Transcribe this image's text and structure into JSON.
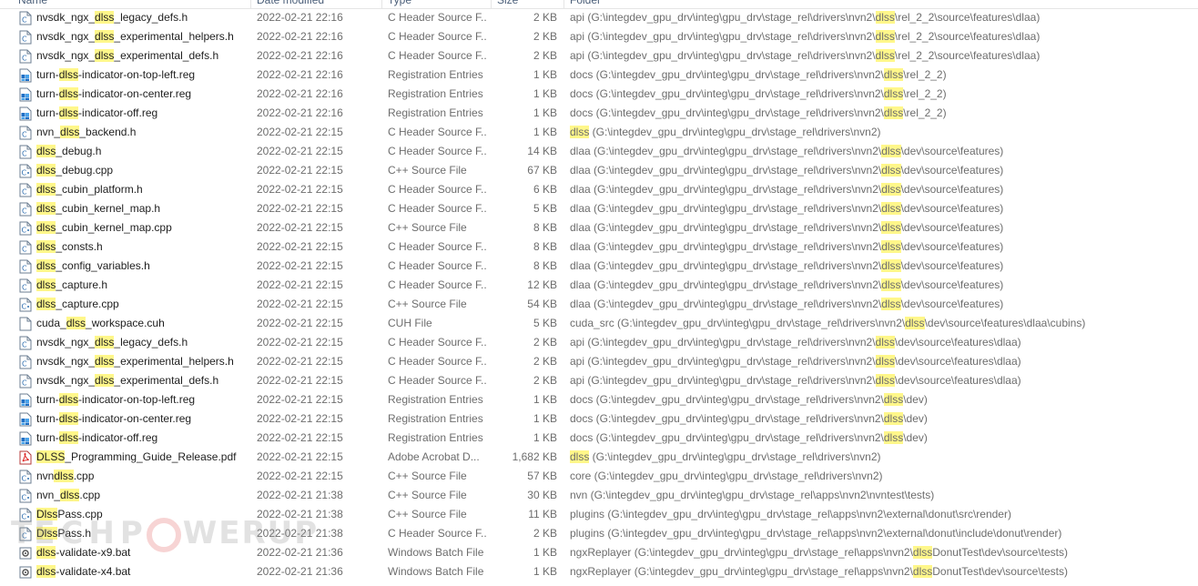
{
  "header": {
    "name": "Name",
    "date_modified": "Date modified",
    "type": "Type",
    "size": "Size",
    "folder": "Folder"
  },
  "highlight_term": "dlss",
  "colors": {
    "highlight": "#fff78a",
    "header_text": "#4c607a",
    "muted_text": "#6d6d6d"
  },
  "rows": [
    {
      "name": "nvsdk_ngx_dlss_legacy_defs.h",
      "date": "2022-02-21 22:16",
      "type": "C Header Source F...",
      "size": "2 KB",
      "folder": "api (G:\\integdev_gpu_drv\\integ\\gpu_drv\\stage_rel\\drivers\\nvn2\\dlss\\rel_2_2\\source\\features\\dlaa)",
      "icon": "c-header-file-icon"
    },
    {
      "name": "nvsdk_ngx_dlss_experimental_helpers.h",
      "date": "2022-02-21 22:16",
      "type": "C Header Source F...",
      "size": "2 KB",
      "folder": "api (G:\\integdev_gpu_drv\\integ\\gpu_drv\\stage_rel\\drivers\\nvn2\\dlss\\rel_2_2\\source\\features\\dlaa)",
      "icon": "c-header-file-icon"
    },
    {
      "name": "nvsdk_ngx_dlss_experimental_defs.h",
      "date": "2022-02-21 22:16",
      "type": "C Header Source F...",
      "size": "2 KB",
      "folder": "api (G:\\integdev_gpu_drv\\integ\\gpu_drv\\stage_rel\\drivers\\nvn2\\dlss\\rel_2_2\\source\\features\\dlaa)",
      "icon": "c-header-file-icon"
    },
    {
      "name": "turn-dlss-indicator-on-top-left.reg",
      "date": "2022-02-21 22:16",
      "type": "Registration Entries",
      "size": "1 KB",
      "folder": "docs (G:\\integdev_gpu_drv\\integ\\gpu_drv\\stage_rel\\drivers\\nvn2\\dlss\\rel_2_2)",
      "icon": "registry-file-icon"
    },
    {
      "name": "turn-dlss-indicator-on-center.reg",
      "date": "2022-02-21 22:16",
      "type": "Registration Entries",
      "size": "1 KB",
      "folder": "docs (G:\\integdev_gpu_drv\\integ\\gpu_drv\\stage_rel\\drivers\\nvn2\\dlss\\rel_2_2)",
      "icon": "registry-file-icon"
    },
    {
      "name": "turn-dlss-indicator-off.reg",
      "date": "2022-02-21 22:16",
      "type": "Registration Entries",
      "size": "1 KB",
      "folder": "docs (G:\\integdev_gpu_drv\\integ\\gpu_drv\\stage_rel\\drivers\\nvn2\\dlss\\rel_2_2)",
      "icon": "registry-file-icon"
    },
    {
      "name": "nvn_dlss_backend.h",
      "date": "2022-02-21 22:15",
      "type": "C Header Source F...",
      "size": "1 KB",
      "folder": "dlss (G:\\integdev_gpu_drv\\integ\\gpu_drv\\stage_rel\\drivers\\nvn2)",
      "icon": "c-header-file-icon"
    },
    {
      "name": "dlss_debug.h",
      "date": "2022-02-21 22:15",
      "type": "C Header Source F...",
      "size": "14 KB",
      "folder": "dlaa (G:\\integdev_gpu_drv\\integ\\gpu_drv\\stage_rel\\drivers\\nvn2\\dlss\\dev\\source\\features)",
      "icon": "c-header-file-icon"
    },
    {
      "name": "dlss_debug.cpp",
      "date": "2022-02-21 22:15",
      "type": "C++ Source File",
      "size": "67 KB",
      "folder": "dlaa (G:\\integdev_gpu_drv\\integ\\gpu_drv\\stage_rel\\drivers\\nvn2\\dlss\\dev\\source\\features)",
      "icon": "cpp-file-icon"
    },
    {
      "name": "dlss_cubin_platform.h",
      "date": "2022-02-21 22:15",
      "type": "C Header Source F...",
      "size": "6 KB",
      "folder": "dlaa (G:\\integdev_gpu_drv\\integ\\gpu_drv\\stage_rel\\drivers\\nvn2\\dlss\\dev\\source\\features)",
      "icon": "c-header-file-icon"
    },
    {
      "name": "dlss_cubin_kernel_map.h",
      "date": "2022-02-21 22:15",
      "type": "C Header Source F...",
      "size": "5 KB",
      "folder": "dlaa (G:\\integdev_gpu_drv\\integ\\gpu_drv\\stage_rel\\drivers\\nvn2\\dlss\\dev\\source\\features)",
      "icon": "c-header-file-icon"
    },
    {
      "name": "dlss_cubin_kernel_map.cpp",
      "date": "2022-02-21 22:15",
      "type": "C++ Source File",
      "size": "8 KB",
      "folder": "dlaa (G:\\integdev_gpu_drv\\integ\\gpu_drv\\stage_rel\\drivers\\nvn2\\dlss\\dev\\source\\features)",
      "icon": "cpp-file-icon"
    },
    {
      "name": "dlss_consts.h",
      "date": "2022-02-21 22:15",
      "type": "C Header Source F...",
      "size": "8 KB",
      "folder": "dlaa (G:\\integdev_gpu_drv\\integ\\gpu_drv\\stage_rel\\drivers\\nvn2\\dlss\\dev\\source\\features)",
      "icon": "c-header-file-icon"
    },
    {
      "name": "dlss_config_variables.h",
      "date": "2022-02-21 22:15",
      "type": "C Header Source F...",
      "size": "8 KB",
      "folder": "dlaa (G:\\integdev_gpu_drv\\integ\\gpu_drv\\stage_rel\\drivers\\nvn2\\dlss\\dev\\source\\features)",
      "icon": "c-header-file-icon"
    },
    {
      "name": "dlss_capture.h",
      "date": "2022-02-21 22:15",
      "type": "C Header Source F...",
      "size": "12 KB",
      "folder": "dlaa (G:\\integdev_gpu_drv\\integ\\gpu_drv\\stage_rel\\drivers\\nvn2\\dlss\\dev\\source\\features)",
      "icon": "c-header-file-icon"
    },
    {
      "name": "dlss_capture.cpp",
      "date": "2022-02-21 22:15",
      "type": "C++ Source File",
      "size": "54 KB",
      "folder": "dlaa (G:\\integdev_gpu_drv\\integ\\gpu_drv\\stage_rel\\drivers\\nvn2\\dlss\\dev\\source\\features)",
      "icon": "cpp-file-icon"
    },
    {
      "name": "cuda_dlss_workspace.cuh",
      "date": "2022-02-21 22:15",
      "type": "CUH File",
      "size": "5 KB",
      "folder": "cuda_src (G:\\integdev_gpu_drv\\integ\\gpu_drv\\stage_rel\\drivers\\nvn2\\dlss\\dev\\source\\features\\dlaa\\cubins)",
      "icon": "generic-file-icon"
    },
    {
      "name": "nvsdk_ngx_dlss_legacy_defs.h",
      "date": "2022-02-21 22:15",
      "type": "C Header Source F...",
      "size": "2 KB",
      "folder": "api (G:\\integdev_gpu_drv\\integ\\gpu_drv\\stage_rel\\drivers\\nvn2\\dlss\\dev\\source\\features\\dlaa)",
      "icon": "c-header-file-icon"
    },
    {
      "name": "nvsdk_ngx_dlss_experimental_helpers.h",
      "date": "2022-02-21 22:15",
      "type": "C Header Source F...",
      "size": "2 KB",
      "folder": "api (G:\\integdev_gpu_drv\\integ\\gpu_drv\\stage_rel\\drivers\\nvn2\\dlss\\dev\\source\\features\\dlaa)",
      "icon": "c-header-file-icon"
    },
    {
      "name": "nvsdk_ngx_dlss_experimental_defs.h",
      "date": "2022-02-21 22:15",
      "type": "C Header Source F...",
      "size": "2 KB",
      "folder": "api (G:\\integdev_gpu_drv\\integ\\gpu_drv\\stage_rel\\drivers\\nvn2\\dlss\\dev\\source\\features\\dlaa)",
      "icon": "c-header-file-icon"
    },
    {
      "name": "turn-dlss-indicator-on-top-left.reg",
      "date": "2022-02-21 22:15",
      "type": "Registration Entries",
      "size": "1 KB",
      "folder": "docs (G:\\integdev_gpu_drv\\integ\\gpu_drv\\stage_rel\\drivers\\nvn2\\dlss\\dev)",
      "icon": "registry-file-icon"
    },
    {
      "name": "turn-dlss-indicator-on-center.reg",
      "date": "2022-02-21 22:15",
      "type": "Registration Entries",
      "size": "1 KB",
      "folder": "docs (G:\\integdev_gpu_drv\\integ\\gpu_drv\\stage_rel\\drivers\\nvn2\\dlss\\dev)",
      "icon": "registry-file-icon"
    },
    {
      "name": "turn-dlss-indicator-off.reg",
      "date": "2022-02-21 22:15",
      "type": "Registration Entries",
      "size": "1 KB",
      "folder": "docs (G:\\integdev_gpu_drv\\integ\\gpu_drv\\stage_rel\\drivers\\nvn2\\dlss\\dev)",
      "icon": "registry-file-icon"
    },
    {
      "name": "DLSS_Programming_Guide_Release.pdf",
      "date": "2022-02-21 22:15",
      "type": "Adobe Acrobat D...",
      "size": "1,682 KB",
      "folder": "dlss (G:\\integdev_gpu_drv\\integ\\gpu_drv\\stage_rel\\drivers\\nvn2)",
      "icon": "pdf-file-icon"
    },
    {
      "name": "nvndlss.cpp",
      "date": "2022-02-21 22:15",
      "type": "C++ Source File",
      "size": "57 KB",
      "folder": "core (G:\\integdev_gpu_drv\\integ\\gpu_drv\\stage_rel\\drivers\\nvn2)",
      "icon": "cpp-file-icon"
    },
    {
      "name": "nvn_dlss.cpp",
      "date": "2022-02-21 21:38",
      "type": "C++ Source File",
      "size": "30 KB",
      "folder": "nvn (G:\\integdev_gpu_drv\\integ\\gpu_drv\\stage_rel\\apps\\nvn2\\nvntest\\tests)",
      "icon": "cpp-file-icon"
    },
    {
      "name": "DlssPass.cpp",
      "date": "2022-02-21 21:38",
      "type": "C++ Source File",
      "size": "11 KB",
      "folder": "plugins (G:\\integdev_gpu_drv\\integ\\gpu_drv\\stage_rel\\apps\\nvn2\\external\\donut\\src\\render)",
      "icon": "cpp-file-icon"
    },
    {
      "name": "DlssPass.h",
      "date": "2022-02-21 21:38",
      "type": "C Header Source F...",
      "size": "2 KB",
      "folder": "plugins (G:\\integdev_gpu_drv\\integ\\gpu_drv\\stage_rel\\apps\\nvn2\\external\\donut\\include\\donut\\render)",
      "icon": "c-header-file-icon"
    },
    {
      "name": "dlss-validate-x9.bat",
      "date": "2022-02-21 21:36",
      "type": "Windows Batch File",
      "size": "1 KB",
      "folder": "ngxReplayer (G:\\integdev_gpu_drv\\integ\\gpu_drv\\stage_rel\\apps\\nvn2\\dlssDonutTest\\dev\\source\\tests)",
      "icon": "batch-file-icon"
    },
    {
      "name": "dlss-validate-x4.bat",
      "date": "2022-02-21 21:36",
      "type": "Windows Batch File",
      "size": "1 KB",
      "folder": "ngxReplayer (G:\\integdev_gpu_drv\\integ\\gpu_drv\\stage_rel\\apps\\nvn2\\dlssDonutTest\\dev\\source\\tests)",
      "icon": "batch-file-icon"
    }
  ]
}
